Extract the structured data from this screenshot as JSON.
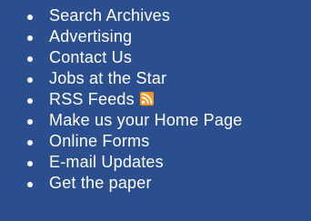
{
  "links": [
    {
      "id": "search-archives",
      "label": "Search Archives"
    },
    {
      "id": "advertising",
      "label": "Advertising"
    },
    {
      "id": "contact-us",
      "label": "Contact Us"
    },
    {
      "id": "jobs-at-the-star",
      "label": "Jobs at the Star"
    },
    {
      "id": "rss-feeds",
      "label": "RSS Feeds",
      "icon": "rss-icon"
    },
    {
      "id": "make-home-page",
      "label": "Make us your Home Page"
    },
    {
      "id": "online-forms",
      "label": "Online Forms"
    },
    {
      "id": "email-updates",
      "label": "E-mail Updates"
    },
    {
      "id": "get-the-paper",
      "label": "Get the paper"
    }
  ],
  "colors": {
    "background": "#2b4f8e",
    "text": "#ffffff",
    "rss_orange": "#f7941d"
  }
}
